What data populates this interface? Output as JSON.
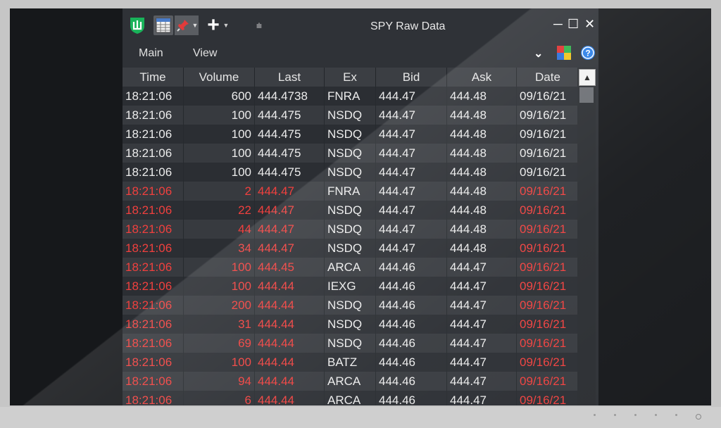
{
  "window": {
    "title": "SPY Raw Data",
    "minimize_glyph": "─",
    "maximize_glyph": "☐",
    "close_glyph": "✕"
  },
  "toolbar": {
    "plus_glyph": "+",
    "dropdown_glyph": "▼",
    "filter_glyph": "⩧",
    "icons": [
      "shield-icon",
      "spreadsheet-icon",
      "pin-icon",
      "plus-icon",
      "filter-icon"
    ]
  },
  "menubar": {
    "items": [
      "Main",
      "View"
    ],
    "collapse_glyph": "⌄",
    "help_glyph": "?"
  },
  "table": {
    "columns": [
      "Time",
      "Volume",
      "Last",
      "Ex",
      "Bid",
      "Ask",
      "Date"
    ],
    "rows": [
      {
        "time": "18:21:06",
        "volume": "600",
        "last": "444.4738",
        "ex": "FNRA",
        "bid": "444.47",
        "ask": "444.48",
        "date": "09/16/21",
        "down": false
      },
      {
        "time": "18:21:06",
        "volume": "100",
        "last": "444.475",
        "ex": "NSDQ",
        "bid": "444.47",
        "ask": "444.48",
        "date": "09/16/21",
        "down": false
      },
      {
        "time": "18:21:06",
        "volume": "100",
        "last": "444.475",
        "ex": "NSDQ",
        "bid": "444.47",
        "ask": "444.48",
        "date": "09/16/21",
        "down": false
      },
      {
        "time": "18:21:06",
        "volume": "100",
        "last": "444.475",
        "ex": "NSDQ",
        "bid": "444.47",
        "ask": "444.48",
        "date": "09/16/21",
        "down": false
      },
      {
        "time": "18:21:06",
        "volume": "100",
        "last": "444.475",
        "ex": "NSDQ",
        "bid": "444.47",
        "ask": "444.48",
        "date": "09/16/21",
        "down": false
      },
      {
        "time": "18:21:06",
        "volume": "2",
        "last": "444.47",
        "ex": "FNRA",
        "bid": "444.47",
        "ask": "444.48",
        "date": "09/16/21",
        "down": true
      },
      {
        "time": "18:21:06",
        "volume": "22",
        "last": "444.47",
        "ex": "NSDQ",
        "bid": "444.47",
        "ask": "444.48",
        "date": "09/16/21",
        "down": true
      },
      {
        "time": "18:21:06",
        "volume": "44",
        "last": "444.47",
        "ex": "NSDQ",
        "bid": "444.47",
        "ask": "444.48",
        "date": "09/16/21",
        "down": true
      },
      {
        "time": "18:21:06",
        "volume": "34",
        "last": "444.47",
        "ex": "NSDQ",
        "bid": "444.47",
        "ask": "444.48",
        "date": "09/16/21",
        "down": true
      },
      {
        "time": "18:21:06",
        "volume": "100",
        "last": "444.45",
        "ex": "ARCA",
        "bid": "444.46",
        "ask": "444.47",
        "date": "09/16/21",
        "down": true
      },
      {
        "time": "18:21:06",
        "volume": "100",
        "last": "444.44",
        "ex": "IEXG",
        "bid": "444.46",
        "ask": "444.47",
        "date": "09/16/21",
        "down": true
      },
      {
        "time": "18:21:06",
        "volume": "200",
        "last": "444.44",
        "ex": "NSDQ",
        "bid": "444.46",
        "ask": "444.47",
        "date": "09/16/21",
        "down": true
      },
      {
        "time": "18:21:06",
        "volume": "31",
        "last": "444.44",
        "ex": "NSDQ",
        "bid": "444.46",
        "ask": "444.47",
        "date": "09/16/21",
        "down": true
      },
      {
        "time": "18:21:06",
        "volume": "69",
        "last": "444.44",
        "ex": "NSDQ",
        "bid": "444.46",
        "ask": "444.47",
        "date": "09/16/21",
        "down": true
      },
      {
        "time": "18:21:06",
        "volume": "100",
        "last": "444.44",
        "ex": "BATZ",
        "bid": "444.46",
        "ask": "444.47",
        "date": "09/16/21",
        "down": true
      },
      {
        "time": "18:21:06",
        "volume": "94",
        "last": "444.44",
        "ex": "ARCA",
        "bid": "444.46",
        "ask": "444.47",
        "date": "09/16/21",
        "down": true
      },
      {
        "time": "18:21:06",
        "volume": "6",
        "last": "444.44",
        "ex": "ARCA",
        "bid": "444.46",
        "ask": "444.47",
        "date": "09/16/21",
        "down": true
      }
    ]
  },
  "colors": {
    "up_text": "#ececec",
    "down_text": "#f0403e",
    "neutral_text": "#ececec",
    "accent_green": "#19b35a",
    "help_blue": "#2a7fe8"
  }
}
